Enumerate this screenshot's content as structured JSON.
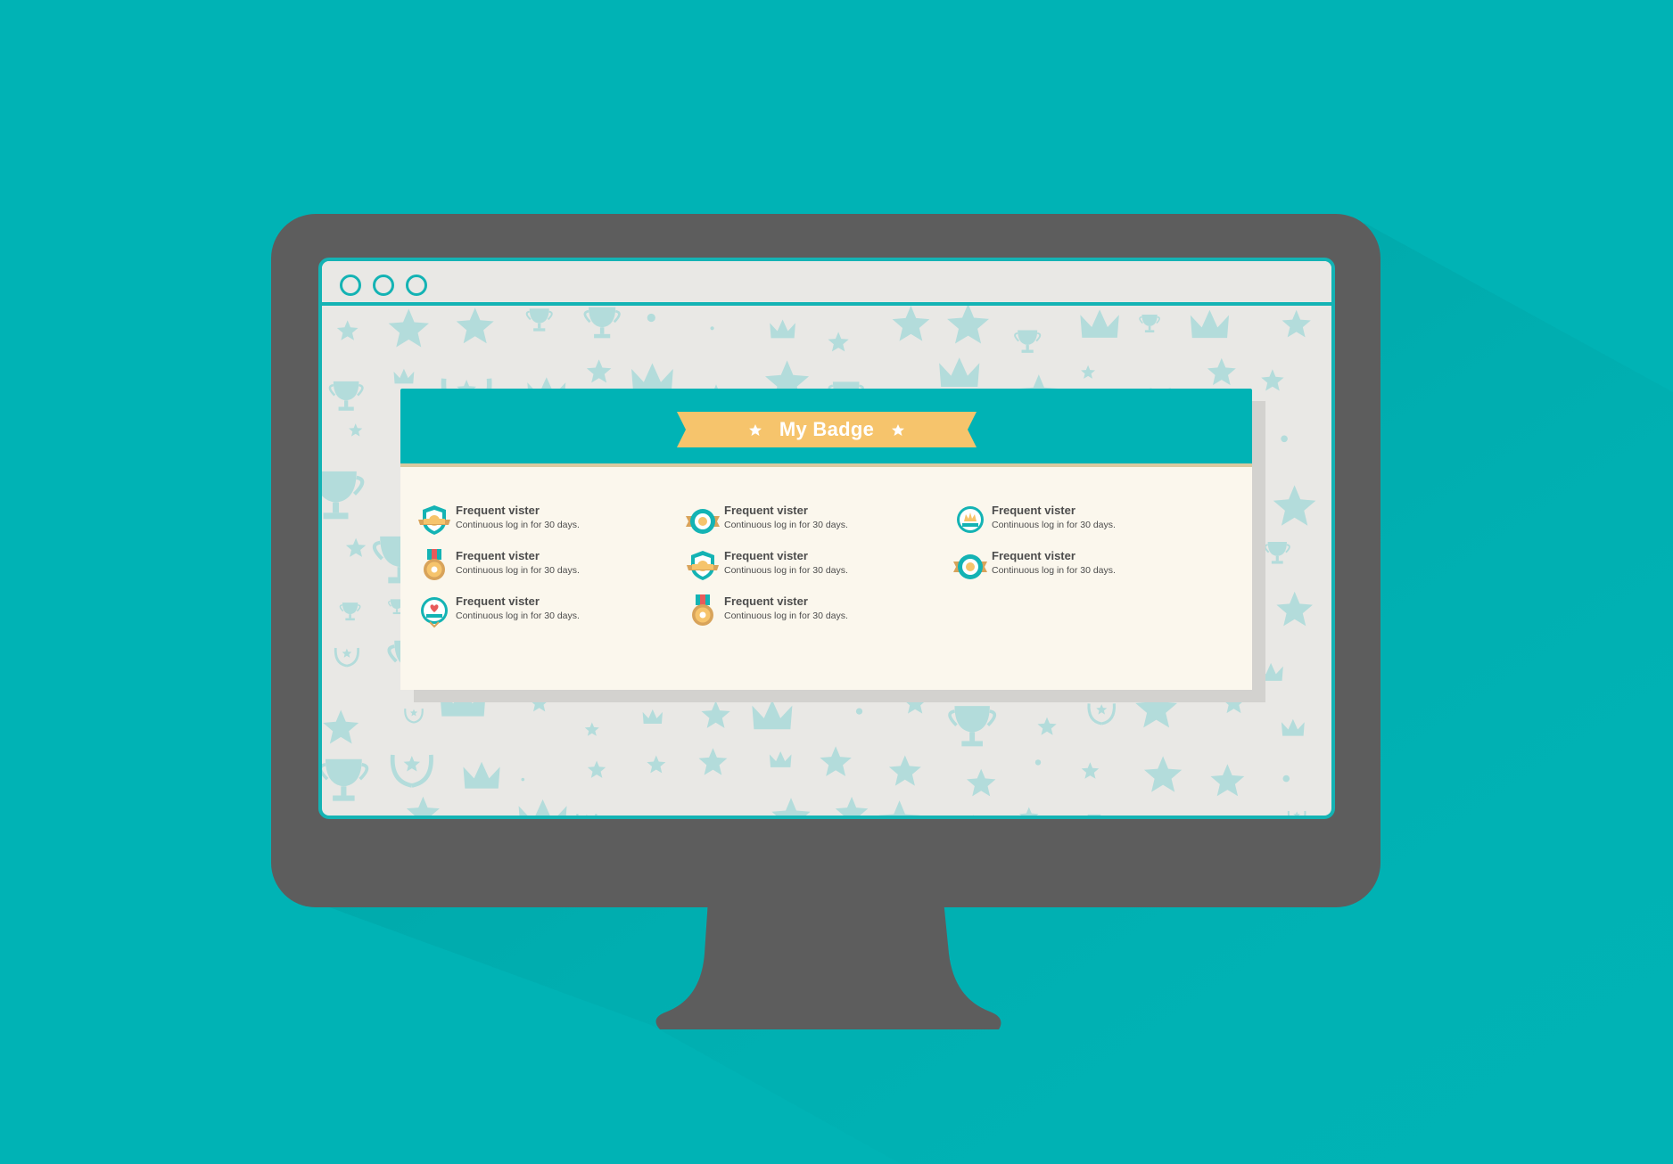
{
  "colors": {
    "background": "#00b3b5",
    "monitor": "#5d5d5d",
    "accent": "#14b3b4",
    "ribbon": "#f6c46c",
    "card": "#fbf7ed"
  },
  "window": {
    "controls": [
      "window-button",
      "window-button",
      "window-button"
    ]
  },
  "panel": {
    "title": "My Badge"
  },
  "badges": [
    {
      "title": "Frequent vister",
      "desc": "Continuous log in for 30 days.",
      "icon": "shield-ribbon-badge-icon"
    },
    {
      "title": "Frequent vister",
      "desc": "Continuous log in for 30 days.",
      "icon": "ring-ribbon-badge-icon"
    },
    {
      "title": "Frequent vister",
      "desc": "Continuous log in for 30 days.",
      "icon": "crown-circle-badge-icon"
    },
    {
      "title": "Frequent vister",
      "desc": "Continuous log in for 30 days.",
      "icon": "medal-badge-icon"
    },
    {
      "title": "Frequent vister",
      "desc": "Continuous log in for 30 days.",
      "icon": "shield-ribbon-badge-icon"
    },
    {
      "title": "Frequent vister",
      "desc": "Continuous log in for 30 days.",
      "icon": "ring-ribbon-badge-icon"
    },
    {
      "title": "Frequent vister",
      "desc": "Continuous log in for 30 days.",
      "icon": "heart-circle-badge-icon"
    },
    {
      "title": "Frequent vister",
      "desc": "Continuous log in for 30 days.",
      "icon": "medal-badge-icon"
    }
  ]
}
